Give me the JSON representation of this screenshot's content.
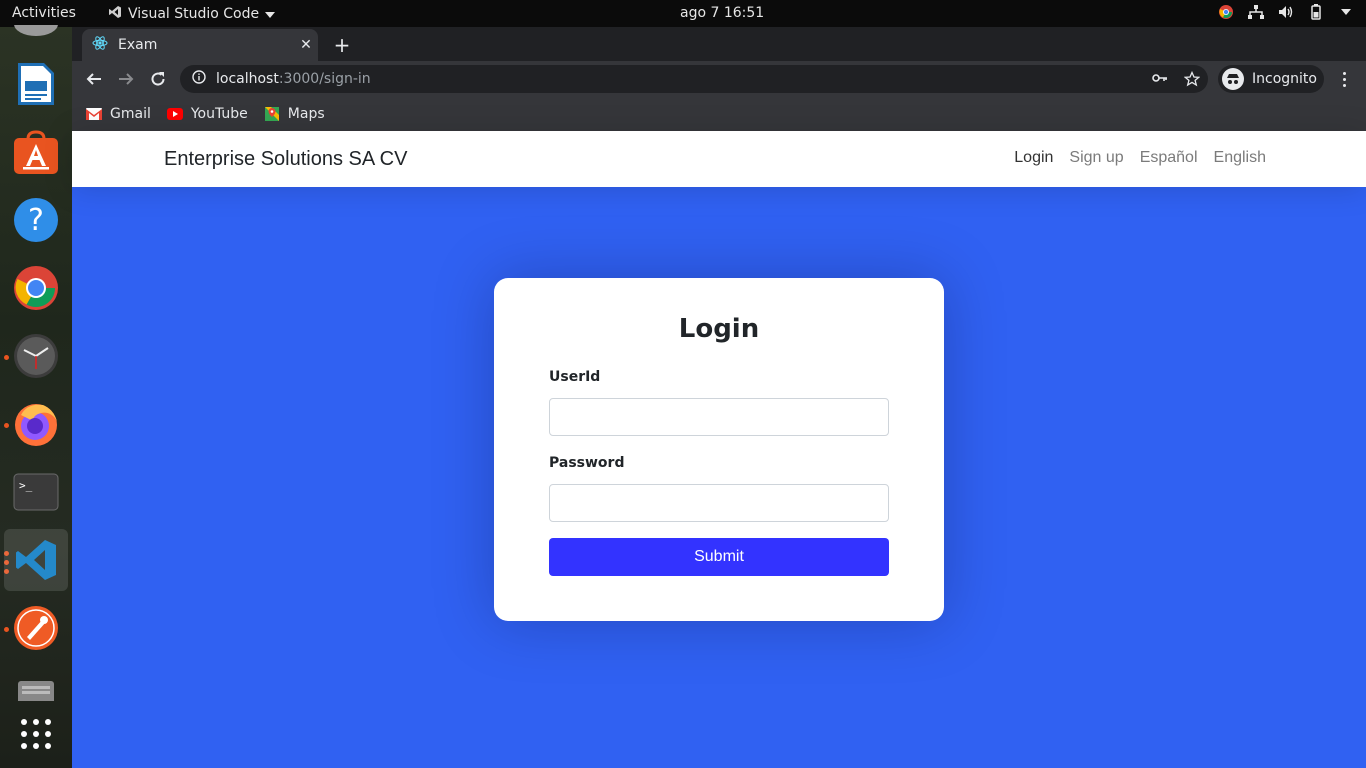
{
  "topbar": {
    "activities": "Activities",
    "app_name": "Visual Studio Code",
    "clock": "ago 7  16:51"
  },
  "dock": {
    "items": [
      "libreoffice-writer-icon",
      "ubuntu-software-icon",
      "help-icon",
      "chrome-icon",
      "clock-icon",
      "firefox-icon",
      "terminal-icon",
      "vscode-icon",
      "postman-icon",
      "files-icon",
      "show-apps-icon"
    ]
  },
  "browser": {
    "tab_title": "Exam",
    "url_host": "localhost",
    "url_path": ":3000/sign-in",
    "incognito_label": "Incognito",
    "bookmarks": [
      "Gmail",
      "YouTube",
      "Maps"
    ]
  },
  "navbar": {
    "brand": "Enterprise Solutions SA CV",
    "links": [
      "Login",
      "Sign up",
      "Español",
      "English"
    ]
  },
  "form": {
    "title": "Login",
    "userid_label": "UserId",
    "password_label": "Password",
    "submit_label": "Submit"
  },
  "colors": {
    "page_bg": "#3061f2",
    "submit_bg": "#3333ff"
  }
}
